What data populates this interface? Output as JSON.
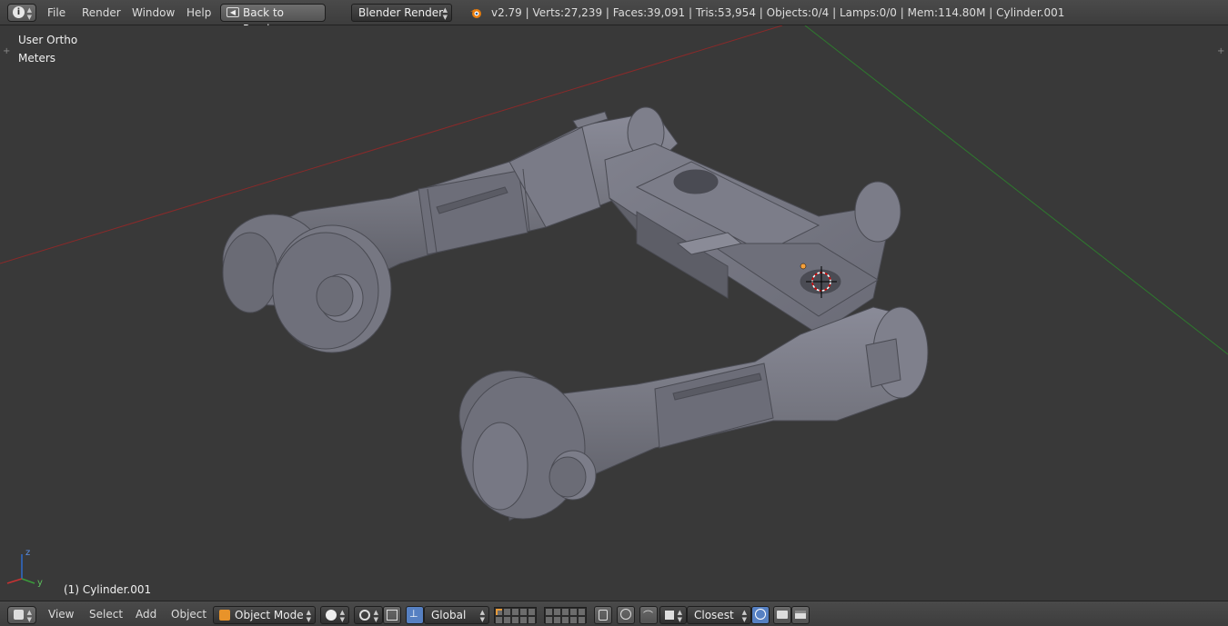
{
  "topbar": {
    "menu": [
      "File",
      "Render",
      "Window",
      "Help"
    ],
    "back_button": "Back to Previous",
    "render_engine": "Blender Render",
    "stats": "v2.79 | Verts:27,239 | Faces:39,091 | Tris:53,954 | Objects:0/4 | Lamps:0/0 | Mem:114.80M | Cylinder.001"
  },
  "viewport": {
    "view_name": "User Ortho",
    "units": "Meters",
    "object_label": "(1) Cylinder.001",
    "axis_labels": {
      "z": "z",
      "y": "y"
    }
  },
  "bottombar": {
    "menu": [
      "View",
      "Select",
      "Add",
      "Object"
    ],
    "mode": "Object Mode",
    "orientation": "Global",
    "snap_target": "Closest"
  },
  "colors": {
    "header_bg": "#424242",
    "viewport_bg": "#393939",
    "x_axis": "#8a2a2a",
    "y_axis": "#2e7a2e",
    "model": "#70717e"
  }
}
